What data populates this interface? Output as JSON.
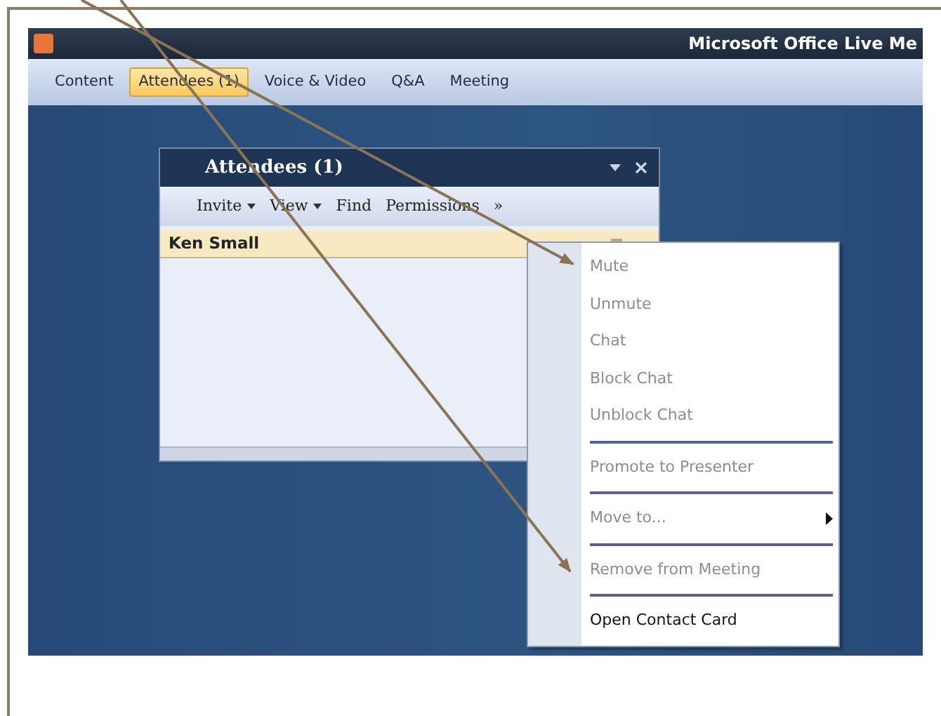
{
  "window": {
    "title": "Microsoft Office Live Me"
  },
  "menu_tabs": [
    {
      "label": "Content",
      "selected": false
    },
    {
      "label": "Attendees (1)",
      "selected": true
    },
    {
      "label": "Voice & Video",
      "selected": false
    },
    {
      "label": "Q&A",
      "selected": false
    },
    {
      "label": "Meeting",
      "selected": false
    }
  ],
  "panel": {
    "title": "Attendees (1)",
    "toolbar": [
      {
        "label": "Invite",
        "dropdown": true
      },
      {
        "label": "View",
        "dropdown": true
      },
      {
        "label": "Find",
        "dropdown": false
      },
      {
        "label": "Permissions",
        "dropdown": false
      },
      {
        "label": "»",
        "dropdown": false
      }
    ],
    "attendees": [
      {
        "name": "Ken Small",
        "selected": true
      }
    ]
  },
  "context_menu": [
    {
      "kind": "item",
      "label": "Mute",
      "disabled": true,
      "submenu": false
    },
    {
      "kind": "item",
      "label": "Unmute",
      "disabled": true,
      "submenu": false
    },
    {
      "kind": "item",
      "label": "Chat",
      "disabled": true,
      "submenu": false
    },
    {
      "kind": "item",
      "label": "Block Chat",
      "disabled": true,
      "submenu": false
    },
    {
      "kind": "item",
      "label": "Unblock Chat",
      "disabled": true,
      "submenu": false
    },
    {
      "kind": "separator"
    },
    {
      "kind": "item",
      "label": "Promote to Presenter",
      "disabled": true,
      "submenu": false
    },
    {
      "kind": "separator"
    },
    {
      "kind": "item",
      "label": "Move to...",
      "disabled": true,
      "submenu": true
    },
    {
      "kind": "separator"
    },
    {
      "kind": "item",
      "label": "Remove from Meeting",
      "disabled": true,
      "submenu": false
    },
    {
      "kind": "separator"
    },
    {
      "kind": "item",
      "label": "Open Contact Card",
      "disabled": false,
      "submenu": false
    }
  ]
}
